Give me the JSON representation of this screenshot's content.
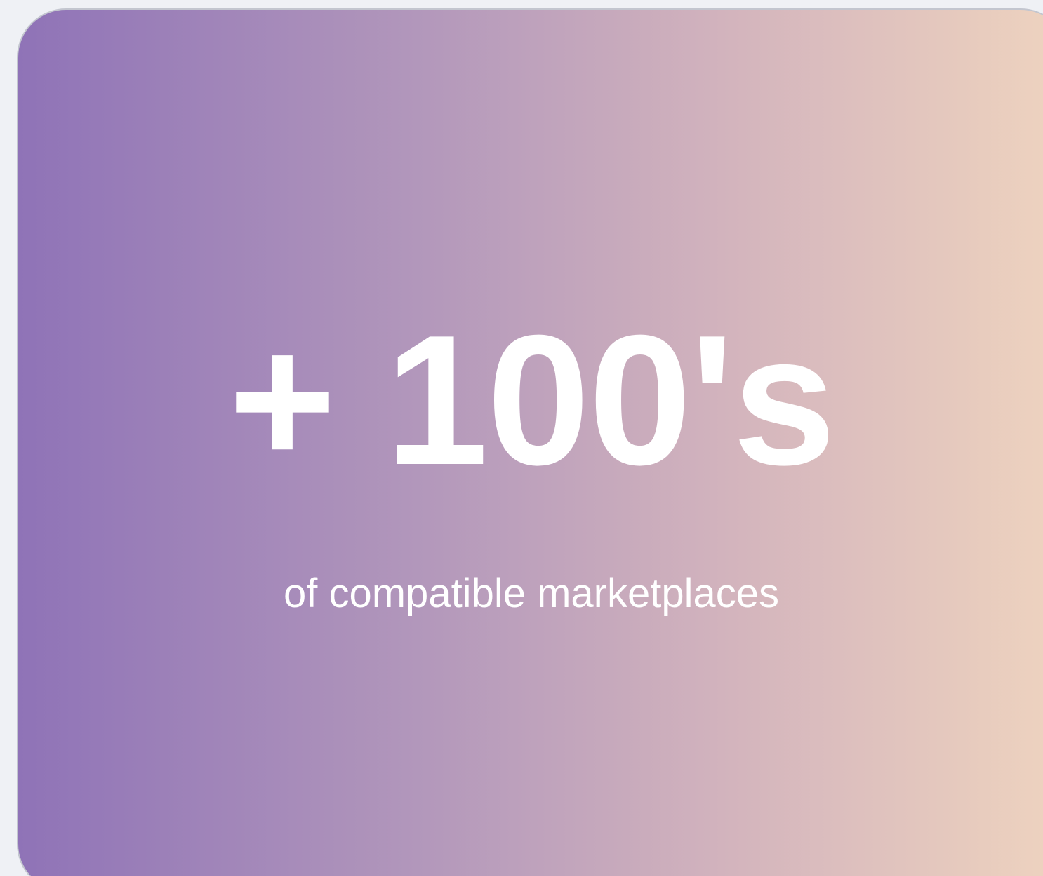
{
  "card": {
    "stat": "+ 100's",
    "caption": "of compatible marketplaces"
  },
  "colors": {
    "page_background": "#eff1f5",
    "gradient_start": "#8f73b7",
    "gradient_end": "#efd4bf",
    "text": "#ffffff"
  }
}
